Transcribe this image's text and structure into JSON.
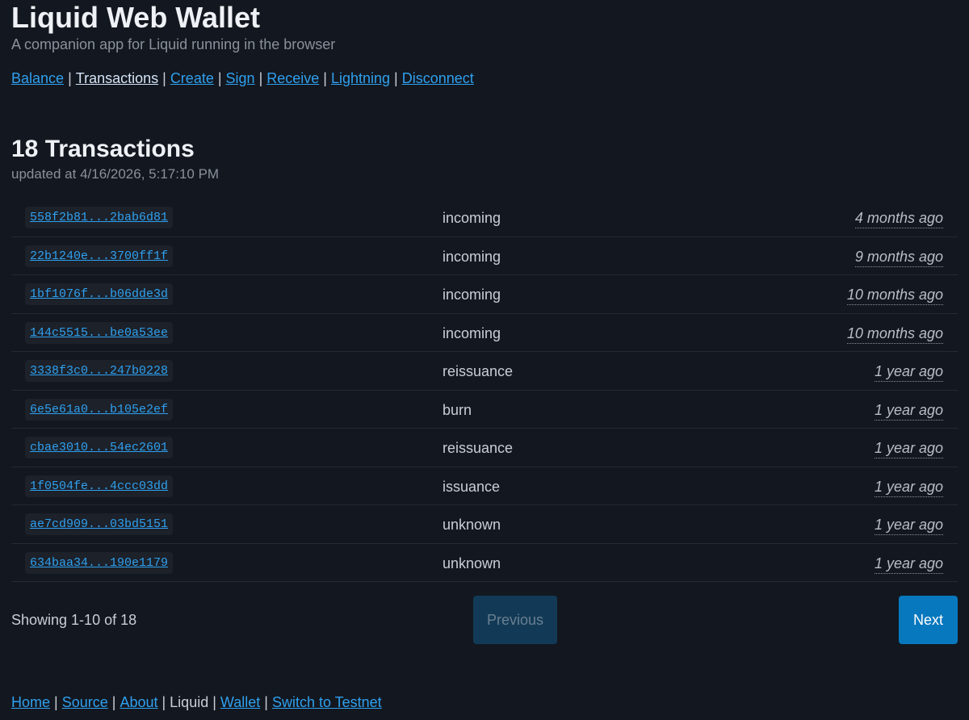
{
  "header": {
    "title": "Liquid Web Wallet",
    "subtitle": "A companion app for Liquid running in the browser"
  },
  "nav": {
    "items": [
      "Balance",
      "Transactions",
      "Create",
      "Sign",
      "Receive",
      "Lightning",
      "Disconnect"
    ],
    "active": "Transactions",
    "separator": "|"
  },
  "transactions": {
    "heading": "18 Transactions",
    "updated": "updated at 4/16/2026, 5:17:10 PM",
    "rows": [
      {
        "id": "558f2b81...2bab6d81",
        "type": "incoming",
        "time": "4 months ago"
      },
      {
        "id": "22b1240e...3700ff1f",
        "type": "incoming",
        "time": "9 months ago"
      },
      {
        "id": "1bf1076f...b06dde3d",
        "type": "incoming",
        "time": "10 months ago"
      },
      {
        "id": "144c5515...be0a53ee",
        "type": "incoming",
        "time": "10 months ago"
      },
      {
        "id": "3338f3c0...247b0228",
        "type": "reissuance",
        "time": "1 year ago"
      },
      {
        "id": "6e5e61a0...b105e2ef",
        "type": "burn",
        "time": "1 year ago"
      },
      {
        "id": "cbae3010...54ec2601",
        "type": "reissuance",
        "time": "1 year ago"
      },
      {
        "id": "1f0504fe...4ccc03dd",
        "type": "issuance",
        "time": "1 year ago"
      },
      {
        "id": "ae7cd909...03bd5151",
        "type": "unknown",
        "time": "1 year ago"
      },
      {
        "id": "634baa34...190e1179",
        "type": "unknown",
        "time": "1 year ago"
      }
    ]
  },
  "pagination": {
    "showing": "Showing 1-10 of 18",
    "previous_label": "Previous",
    "next_label": "Next"
  },
  "footer": {
    "links": [
      "Home",
      "Source",
      "About",
      "Liquid",
      "Wallet",
      "Switch to Testnet"
    ],
    "current": "Liquid"
  },
  "colors": {
    "background": "#13171f",
    "link": "#2fa0ee",
    "next_button": "#0878be",
    "previous_button_disabled": "#123a56"
  }
}
